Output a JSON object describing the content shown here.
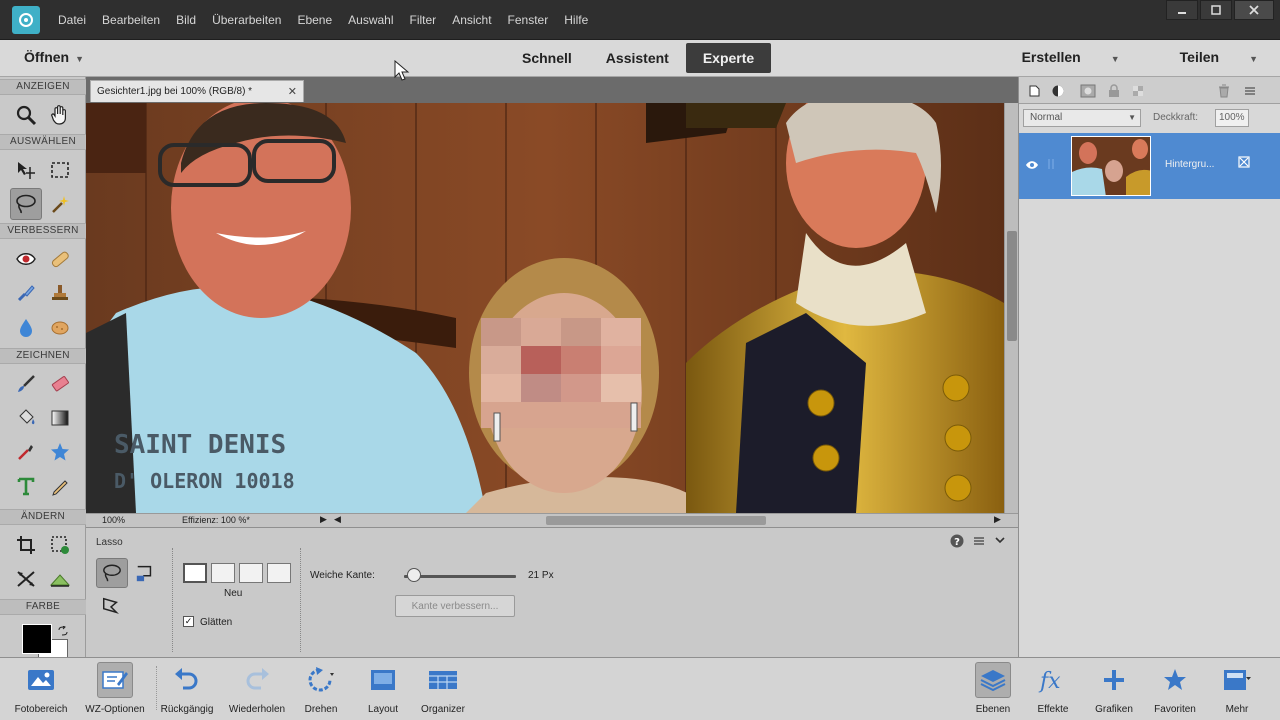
{
  "menubar": {
    "items": [
      "Datei",
      "Bearbeiten",
      "Bild",
      "Überarbeiten",
      "Ebene",
      "Auswahl",
      "Filter",
      "Ansicht",
      "Fenster",
      "Hilfe"
    ]
  },
  "modebar": {
    "open_label": "Öffnen",
    "tabs": [
      "Schnell",
      "Assistent",
      "Experte"
    ],
    "active_tab": "Experte",
    "create_label": "Erstellen",
    "share_label": "Teilen"
  },
  "toolbox": {
    "sections": [
      "ANZEIGEN",
      "AUSWÄHLEN",
      "VERBESSERN",
      "ZEICHNEN",
      "ÄNDERN",
      "FARBE"
    ],
    "colors": {
      "foreground": "#000000",
      "background": "#ffffff"
    }
  },
  "document": {
    "tab_title": "Gesichter1.jpg bei 100% (RGB/8) *",
    "zoom": "100%",
    "efficiency": "Effizienz: 100 %*",
    "shirt_text_line1": "SAINT DENIS",
    "shirt_text_line2": "D' OLERON 10018"
  },
  "options": {
    "tool_name": "Lasso",
    "new_label": "Neu",
    "smooth_label": "Glätten",
    "feather_label": "Weiche Kante:",
    "feather_value": "21 Px",
    "feather_level": 0.1,
    "refine_button": "Kante verbessern..."
  },
  "layers": {
    "blend_mode": "Normal",
    "opacity_label": "Deckkraft:",
    "opacity_value": "100%",
    "layer_name": "Hintergru..."
  },
  "bottombar": {
    "left": [
      "Fotobereich",
      "WZ-Optionen",
      "Rückgängig",
      "Wiederholen",
      "Drehen",
      "Layout",
      "Organizer"
    ],
    "right": [
      "Ebenen",
      "Effekte",
      "Grafiken",
      "Favoriten",
      "Mehr"
    ]
  },
  "colors": {
    "accent": "#3fb0c7",
    "layer_selected": "#4f8ad1",
    "active_tab_bg": "#3c3c3c"
  }
}
